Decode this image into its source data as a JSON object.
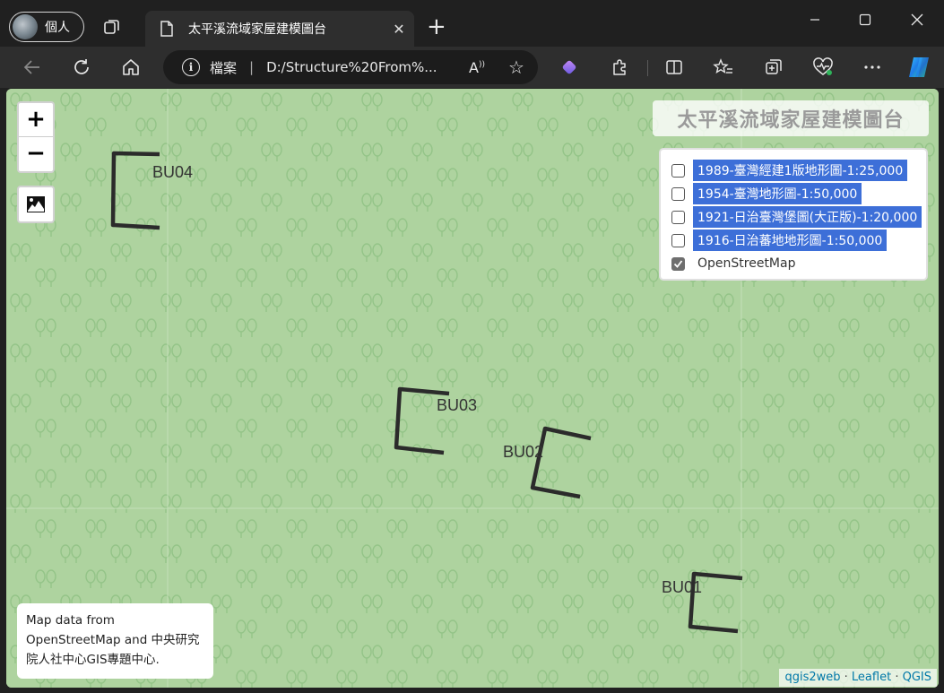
{
  "browser": {
    "profile_label": "個人",
    "tab_title": "太平溪流域家屋建模圖台",
    "address_scheme": "檔案",
    "address_url": "D:/Structure%20From%...",
    "icons": [
      "workspaces-icon",
      "page-icon",
      "close-icon",
      "new-tab-icon",
      "back-icon",
      "refresh-icon",
      "home-icon",
      "info-icon",
      "read-aloud-icon",
      "favorite-icon",
      "copilot-diamond-icon",
      "extensions-icon",
      "split-screen-icon",
      "favorites-list-icon",
      "collections-icon",
      "browser-essentials-icon",
      "more-icon",
      "copilot-icon",
      "minimize-icon",
      "maximize-icon",
      "window-close-icon"
    ]
  },
  "map": {
    "title": "太平溪流域家屋建模圖台",
    "zoom_in": "+",
    "zoom_out": "−",
    "layers": [
      {
        "label": "1989-臺灣經建1版地形圖-1:25,000",
        "checked": false
      },
      {
        "label": "1954-臺灣地形圖-1:50,000",
        "checked": false
      },
      {
        "label": "1921-日治臺灣堡圖(大正版)-1:20,000",
        "checked": false
      },
      {
        "label": "1916-日治蕃地地形圖-1:50,000",
        "checked": false
      },
      {
        "label": "OpenStreetMap",
        "checked": true
      }
    ],
    "buildings": [
      {
        "label": "BU04"
      },
      {
        "label": "BU03"
      },
      {
        "label": "BU02"
      },
      {
        "label": "BU01"
      }
    ],
    "attribution": "Map data from OpenStreetMap and 中央研究院人社中心GIS專題中心.",
    "credits": [
      "qgis2web",
      "Leaflet",
      "QGIS"
    ],
    "colors": {
      "background": "#aed39f",
      "tree": "#8fbf82",
      "outline": "#2b2b2b",
      "selection": "#3d6fd8"
    }
  }
}
